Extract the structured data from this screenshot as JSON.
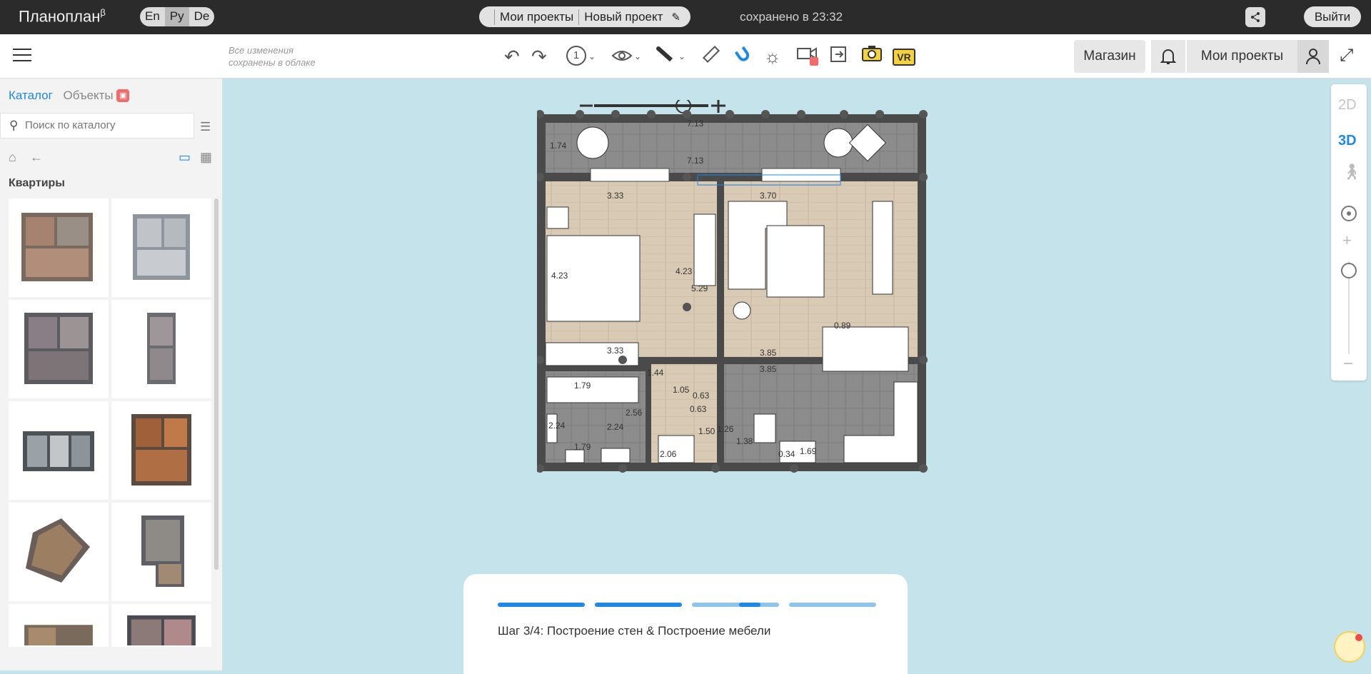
{
  "header": {
    "logo": "Планоплан",
    "logo_sup": "β",
    "languages": [
      "En",
      "Ру",
      "De"
    ],
    "active_language": "Ру",
    "breadcrumb_projects": "Мои проекты",
    "breadcrumb_current": "Новый проект",
    "saved_status": "сохранено в 23:32",
    "logout": "Выйти"
  },
  "toolbar": {
    "cloud_note_line1": "Все изменения",
    "cloud_note_line2": "сохранены в облаке",
    "floor_number": "1",
    "vr_label": "VR",
    "shop": "Магазин",
    "my_projects": "Мои проекты"
  },
  "sidebar": {
    "tab_catalog": "Каталог",
    "tab_objects": "Объекты",
    "search_placeholder": "Поиск по каталогу",
    "category_title": "Квартиры"
  },
  "view_panel": {
    "mode_2d": "2D",
    "mode_3d": "3D",
    "active_mode": "3D"
  },
  "plan": {
    "dims": {
      "balcony_top": "7.13",
      "balcony_bottom": "7.13",
      "balcony_side": "1.74",
      "bedroom_top": "3.33",
      "bedroom_left": "4.23",
      "bedroom_right": "4.23",
      "bedroom_bottom": "3.33",
      "living_top": "3.70",
      "living_left": "5.29",
      "living_right": "0.89",
      "living_bottom": "3.85",
      "kitchen_top": "3.85",
      "hall_top": "1.44",
      "hall_right": "1.05",
      "hall_left": "2.56",
      "hall_bottom": "2.06",
      "bath_top": "1.79",
      "bath_bottom": "1.79",
      "bath_left": "2.24",
      "bath_right": "2.24",
      "wc_top": "0.63",
      "wc_mid": "0.63",
      "wc_side": "1.50",
      "wc_right": "1.26",
      "kitchen_small": "1.38",
      "kitchen_bottom": "1.69",
      "kitchen_corner": "0.34",
      "door_gap": "0.63"
    }
  },
  "step": {
    "text": "Шаг 3/4: Построение стен & Построение мебели",
    "progress": 0.7
  },
  "colors": {
    "accent": "#1e88e5",
    "topbar": "#2b2b2b",
    "canvas": "#c5e3ea",
    "wall": "#4a4a4a",
    "floor_wood": "#d7c8b4",
    "floor_tile": "#8a8a8a"
  }
}
